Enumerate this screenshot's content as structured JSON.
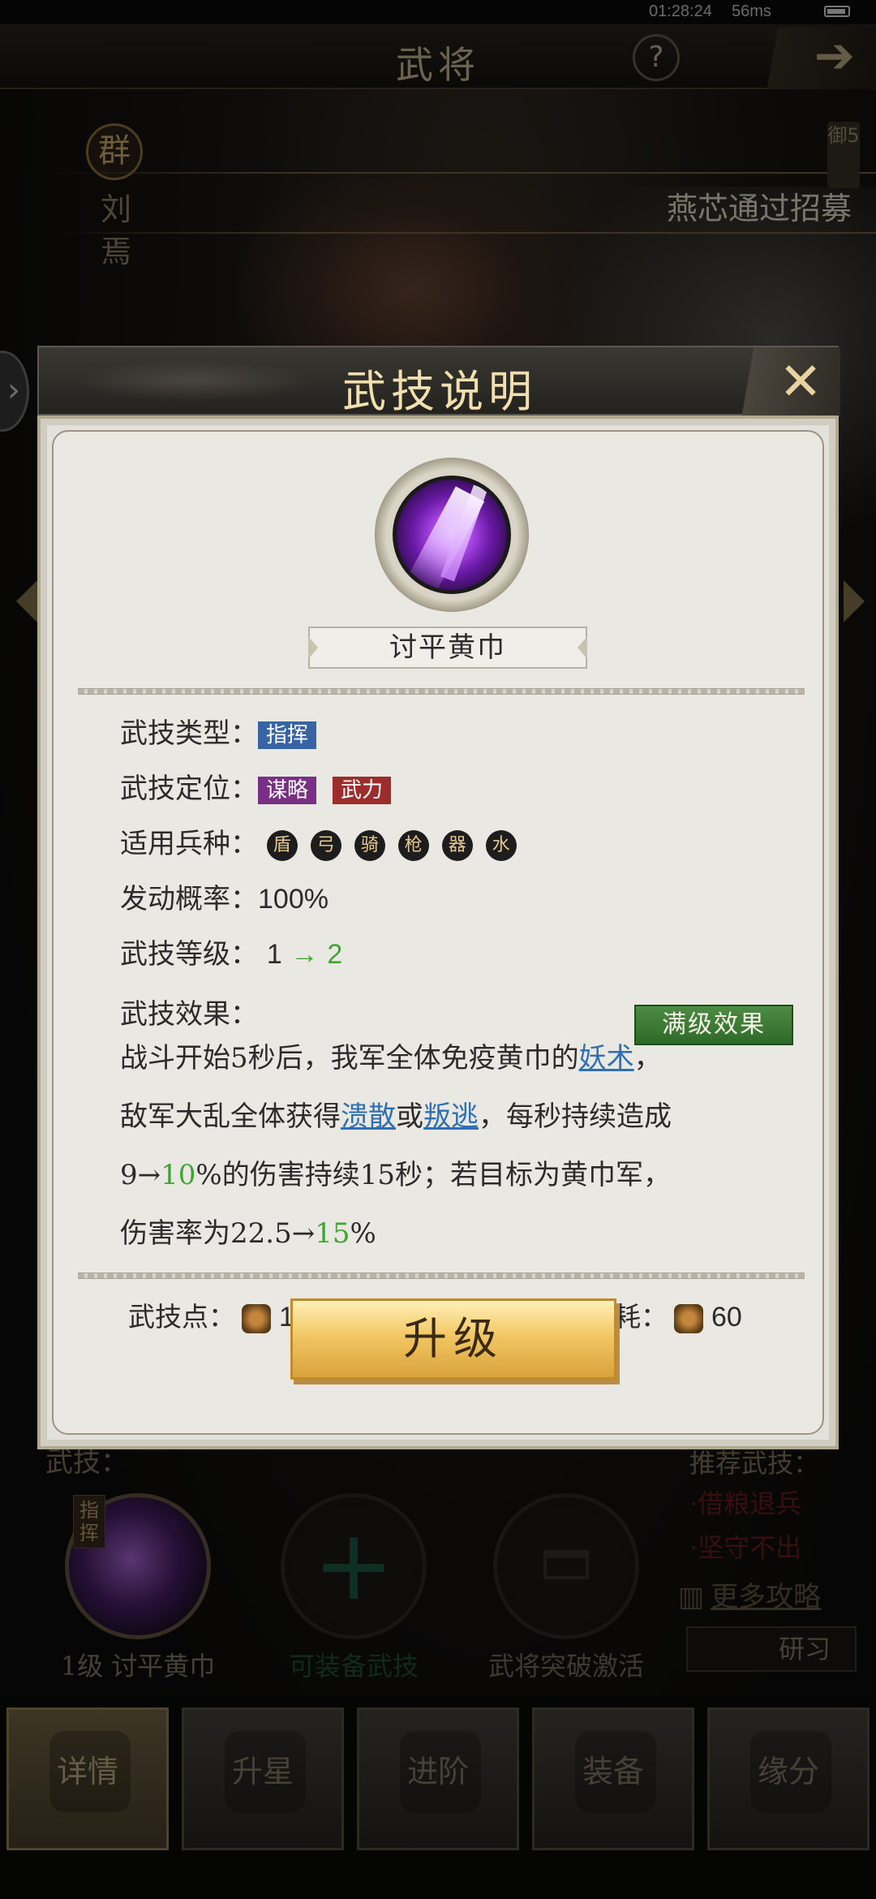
{
  "status_bar": {
    "time": "01:28:24",
    "network": "56ms"
  },
  "header": {
    "title": "武将",
    "help": "?",
    "back": "➔"
  },
  "general": {
    "faction": "群",
    "name": "刘焉",
    "rank": "御5"
  },
  "notice": "燕芯通过招募",
  "modal": {
    "title": "武技说明",
    "skill_name": "讨平黄巾",
    "type_label": "武技类型：",
    "type_tag": "指挥",
    "position_label": "武技定位：",
    "position_tags": [
      "谋略",
      "武力"
    ],
    "troops_label": "适用兵种：",
    "troops": [
      "盾",
      "弓",
      "骑",
      "枪",
      "器",
      "水"
    ],
    "rate_label": "发动概率：",
    "rate_value": "100%",
    "level_label": "武技等级：",
    "level_from": "1",
    "level_arrow": "→",
    "level_to": "2",
    "effect_label": "武技效果：",
    "max_effect_button": "满级效果",
    "effect": {
      "l1_a": "战斗开始5秒后，我军全体免疫黄巾的",
      "l1_link": "妖术",
      "l1_b": "，",
      "l2_a": "敌军大乱全体获得",
      "l2_link1": "溃散",
      "l2_b": "或",
      "l2_link2": "叛逃",
      "l2_c": "，每秒持续造成",
      "l3_a": "9→",
      "l3_b": "10",
      "l3_c": "%的伤害持续15秒；若目标为黄巾军，",
      "l4_a": "伤害率为22.5→",
      "l4_b": "15",
      "l4_c": "%"
    },
    "points_label": "武技点：",
    "points_value": "130",
    "cost_label": "升级消耗：",
    "cost_value": "60",
    "upgrade_button": "升级"
  },
  "lower": {
    "skill_label": "武技：",
    "recommend_label": "推荐武技：",
    "slots": [
      {
        "caption": "1级 讨平黄巾",
        "tag": "指挥"
      },
      {
        "caption": "可装备武技"
      },
      {
        "caption": "武将突破激活"
      }
    ],
    "recommend": [
      "·借粮退兵",
      "·坚守不出"
    ],
    "more_guide": "更多攻略",
    "study": "研习"
  },
  "bottom_nav": [
    "详情",
    "升星",
    "进阶",
    "装备",
    "缘分"
  ],
  "colors": {
    "accent_gold": "#f2c764",
    "tag_blue": "#3864a6",
    "tag_purple": "#7a2f87",
    "tag_red": "#9e2c2c",
    "upgrade_green": "#3fa631",
    "link_blue": "#2e6fb6"
  }
}
